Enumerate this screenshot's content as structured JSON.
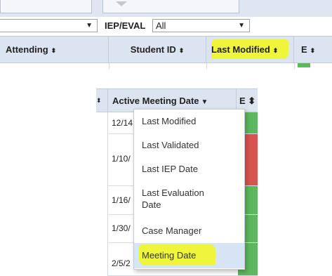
{
  "top": {
    "filter1": {
      "value": "",
      "arrow": "▼"
    },
    "filter2": {
      "label": "IEP/EVAL",
      "value": "All",
      "arrow": "▼"
    },
    "sort_icon": "⬍",
    "columns": [
      {
        "label": "Attending",
        "sort": "⬍"
      },
      {
        "label": "Student ID",
        "sort": "⬍"
      },
      {
        "label": "Last Modified",
        "sort": "⬍"
      },
      {
        "label": "E",
        "sort": "⬍"
      }
    ]
  },
  "table": {
    "left_sort": "⬍",
    "header": {
      "label": "Active Meeting Date",
      "arrow": "▼"
    },
    "e_header": "E ⬍",
    "rows": [
      {
        "date": "12/14",
        "status_color": "#5cb85c"
      },
      {
        "date": "1/10/",
        "status_color": "#d9534f"
      },
      {
        "date": "1/16/",
        "status_color": "#5cb85c"
      },
      {
        "date": "1/30/",
        "status_color": "#5cb85c"
      },
      {
        "date": "2/5/2",
        "status_color": "#5cb85c"
      }
    ]
  },
  "menu": {
    "items": [
      {
        "label": "Last Modified"
      },
      {
        "label": "Last Validated"
      },
      {
        "label": "Last IEP Date"
      },
      {
        "label": "Last Evaluation",
        "label2": "Date"
      },
      {
        "label": "Case Manager"
      },
      {
        "label": "Meeting Date",
        "selected": true
      }
    ]
  },
  "colors": {
    "highlight": "#eef53a",
    "header_bg": "#dce4f1",
    "green": "#5cb85c",
    "red": "#d9534f"
  }
}
